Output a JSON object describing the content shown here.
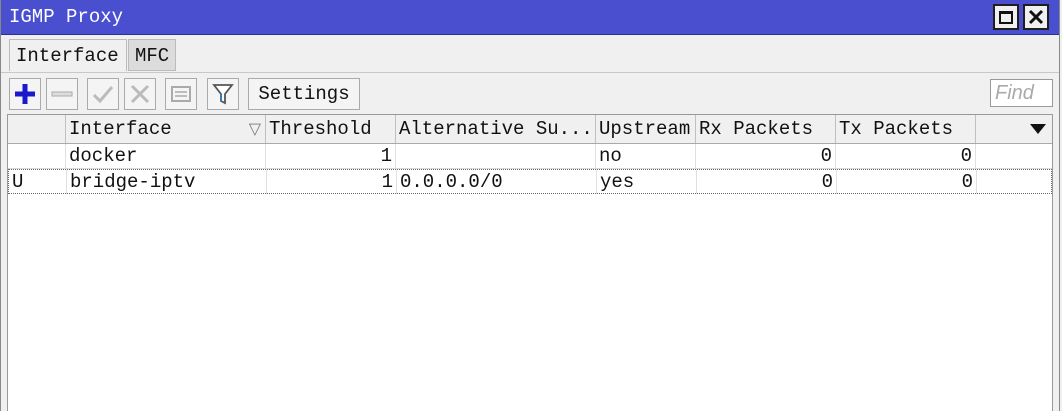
{
  "window": {
    "title": "IGMP Proxy"
  },
  "tabs": [
    {
      "label": "Interface",
      "active": true
    },
    {
      "label": "MFC",
      "active": false
    }
  ],
  "toolbar": {
    "settings_label": "Settings",
    "find_placeholder": "Find",
    "accent": "#1a1acc"
  },
  "table": {
    "columns": [
      "",
      "Interface",
      "Threshold",
      "Alternative Su...",
      "Upstream",
      "Rx Packets",
      "Tx Packets"
    ],
    "rows": [
      {
        "flag": "",
        "interface": "docker",
        "threshold": "1",
        "alt_subnet": "",
        "upstream": "no",
        "rx": "0",
        "tx": "0"
      },
      {
        "flag": "U",
        "interface": "bridge-iptv",
        "threshold": "1",
        "alt_subnet": "0.0.0.0/0",
        "upstream": "yes",
        "rx": "0",
        "tx": "0"
      }
    ]
  }
}
